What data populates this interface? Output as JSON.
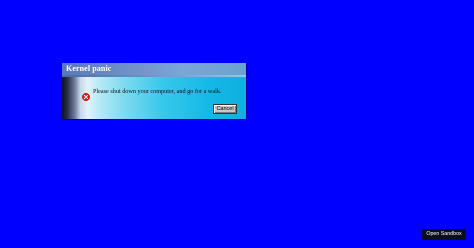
{
  "desktop": {
    "background_color": "#0000fe"
  },
  "dialog": {
    "title": "Kernel panic",
    "message": "Please shut down your computer, and go for a walk.",
    "icon": "error-icon",
    "icon_color": "#e01010",
    "cancel_label": "Cancel"
  },
  "sandbox_button": {
    "label": "Open Sandbox"
  }
}
